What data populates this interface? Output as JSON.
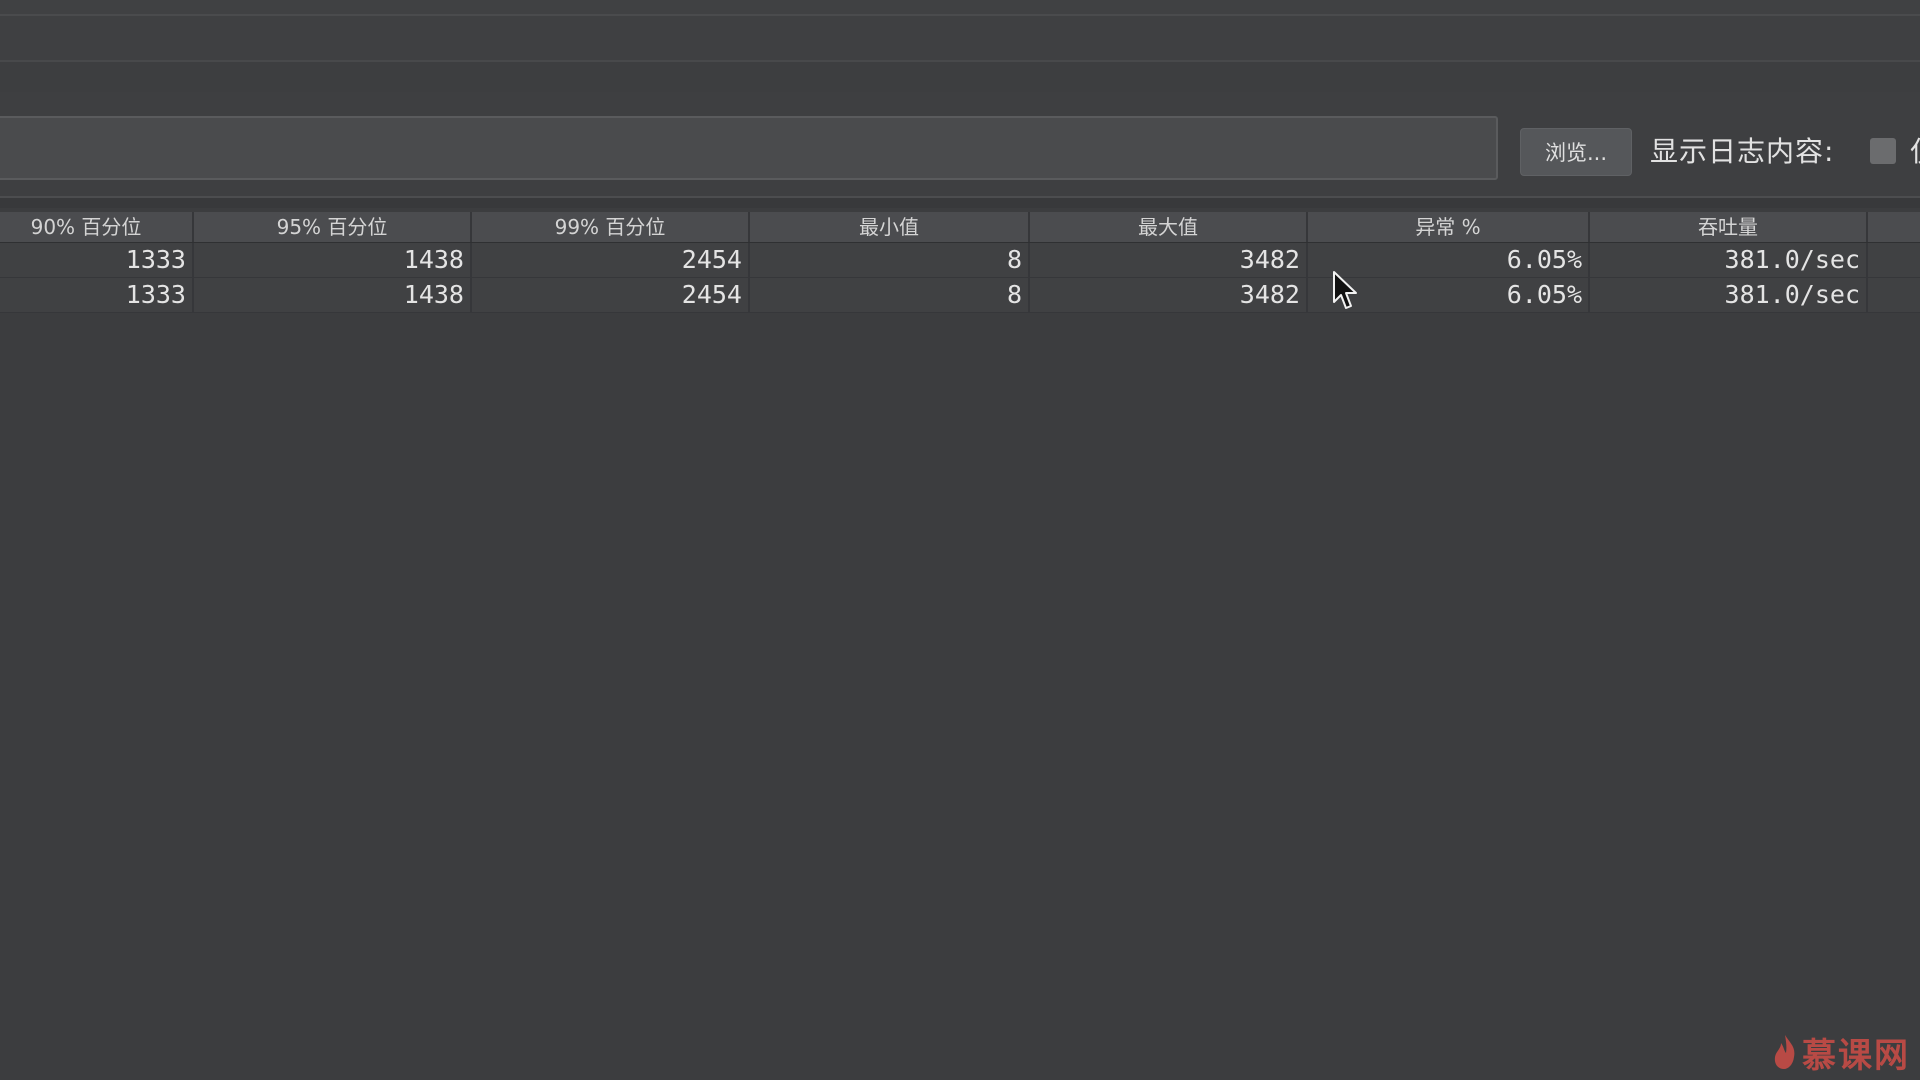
{
  "toolbar": {
    "browse_label": "浏览...",
    "log_label": "显示日志内容:",
    "clipped_label": "仅"
  },
  "table": {
    "headers": [
      "90% 百分位",
      "95% 百分位",
      "99% 百分位",
      "最小值",
      "最大值",
      "异常 %",
      "吞吐量",
      ""
    ],
    "rows": [
      [
        "1333",
        "1438",
        "2454",
        "8",
        "3482",
        "6.05%",
        "381.0/sec",
        ""
      ],
      [
        "1333",
        "1438",
        "2454",
        "8",
        "3482",
        "6.05%",
        "381.0/sec",
        ""
      ]
    ]
  },
  "watermark": {
    "text": "慕课网"
  },
  "colors": {
    "background": "#3c3d3f",
    "header": "#4b4c4f",
    "watermark": "#b84a45"
  }
}
